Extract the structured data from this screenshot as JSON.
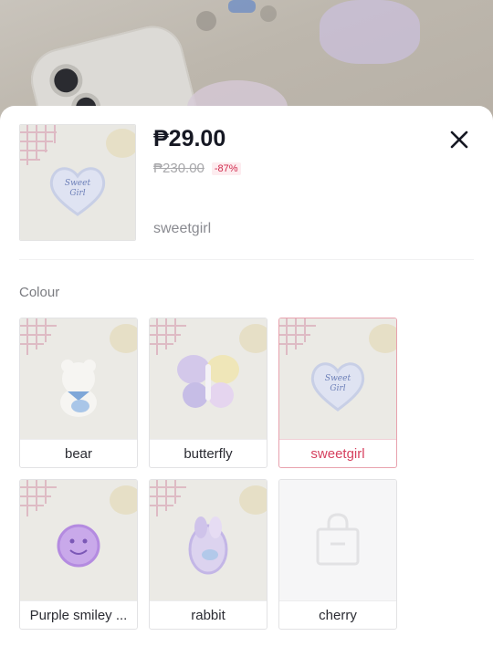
{
  "product": {
    "price": "₱29.00",
    "original_price": "₱230.00",
    "discount": "-87%",
    "selected_variant": "sweetgirl"
  },
  "variants": {
    "section_label": "Colour",
    "options": [
      {
        "label": "bear",
        "selected": false,
        "available": true
      },
      {
        "label": "butterfly",
        "selected": false,
        "available": true
      },
      {
        "label": "sweetgirl",
        "selected": true,
        "available": true
      },
      {
        "label": "Purple smiley ...",
        "selected": false,
        "available": true
      },
      {
        "label": "rabbit",
        "selected": false,
        "available": true
      },
      {
        "label": "cherry",
        "selected": false,
        "available": true
      }
    ]
  },
  "icons": {
    "close": "close-icon",
    "placeholder": "shopping-bag-icon"
  },
  "colors": {
    "accent": "#d6415f",
    "discount_bg": "#fdecef",
    "selected_border": "#e8a2ae"
  }
}
